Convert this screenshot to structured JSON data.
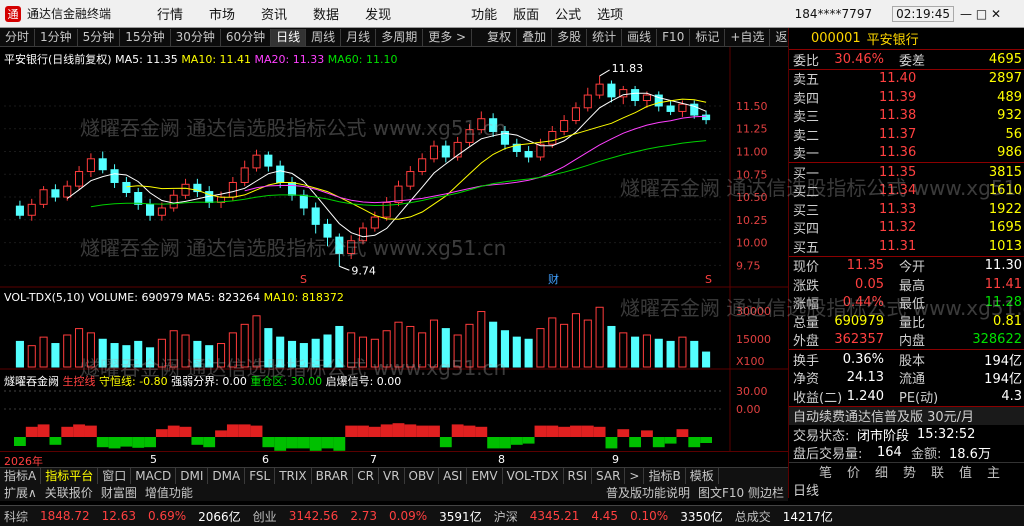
{
  "titlebar": {
    "app_title": "通达信金融终端",
    "menus": [
      "行情",
      "市场",
      "资讯",
      "数据",
      "发现"
    ],
    "menus2": [
      "功能",
      "版面",
      "公式",
      "选项"
    ],
    "user": "184****7797",
    "time": "02:19:45",
    "controls": "— □ ✕"
  },
  "toolbar": {
    "periods": [
      "分时",
      "1分钟",
      "5分钟",
      "15分钟",
      "30分钟",
      "60分钟",
      "日线",
      "周线",
      "月线",
      "多周期",
      "更多 >"
    ],
    "active": "日线",
    "tools": [
      "复权",
      "叠加",
      "多股",
      "统计",
      "画线",
      "F10",
      "标记",
      "+自选",
      "返回"
    ]
  },
  "chart": {
    "main_title": "平安银行(日线前复权)",
    "ma5": "MA5: 11.35",
    "ma10": "MA10: 11.41",
    "ma20": "MA20: 11.33",
    "ma60": "MA60: 11.10",
    "y_ticks": [
      "11.50",
      "11.25",
      "11.00",
      "10.75",
      "10.50",
      "10.25",
      "10.00",
      "9.75"
    ],
    "high_mark": "11.83",
    "low_mark": "9.74",
    "event_marks": [
      "S",
      "财",
      "S"
    ],
    "vol_title": "VOL-TDX(5,10)",
    "volume": "VOLUME: 690979",
    "vol_ma5": "MA5: 823264",
    "vol_ma10": "MA10: 818372",
    "vol_ticks": [
      "30000",
      "15000",
      "X100"
    ],
    "ind_title": "燧曜吞金阙",
    "ind_a": "生控线",
    "ind_b": "守恒线: -0.80",
    "ind_c": "强弱分界: 0.00",
    "ind_d": "重仓区: 30.00",
    "ind_e": "启爆信号: 0.00",
    "ind_ticks": [
      "30.00",
      "0.00"
    ],
    "date_labels": [
      "2026年",
      "5",
      "6",
      "7",
      "8",
      "9"
    ],
    "watermark": "燧曜吞金阙 通达信选股指标公式 www.xg51.cn"
  },
  "chart_data": {
    "type": "candlestick",
    "ylim": [
      9.6,
      11.95
    ],
    "candles": [
      [
        10.4,
        10.3,
        10.46,
        10.26
      ],
      [
        10.3,
        10.42,
        10.48,
        10.24
      ],
      [
        10.42,
        10.58,
        10.62,
        10.38
      ],
      [
        10.58,
        10.5,
        10.64,
        10.45
      ],
      [
        10.5,
        10.62,
        10.68,
        10.46
      ],
      [
        10.62,
        10.78,
        10.84,
        10.58
      ],
      [
        10.78,
        10.92,
        10.98,
        10.72
      ],
      [
        10.92,
        10.8,
        11.0,
        10.76
      ],
      [
        10.8,
        10.66,
        10.86,
        10.6
      ],
      [
        10.66,
        10.55,
        10.72,
        10.5
      ],
      [
        10.55,
        10.42,
        10.6,
        10.36
      ],
      [
        10.42,
        10.3,
        10.48,
        10.24
      ],
      [
        10.3,
        10.38,
        10.44,
        10.24
      ],
      [
        10.38,
        10.52,
        10.58,
        10.34
      ],
      [
        10.52,
        10.64,
        10.7,
        10.48
      ],
      [
        10.64,
        10.56,
        10.7,
        10.5
      ],
      [
        10.56,
        10.44,
        10.62,
        10.38
      ],
      [
        10.44,
        10.5,
        10.56,
        10.38
      ],
      [
        10.5,
        10.66,
        10.72,
        10.46
      ],
      [
        10.66,
        10.82,
        10.9,
        10.62
      ],
      [
        10.82,
        10.96,
        11.02,
        10.78
      ],
      [
        10.96,
        10.84,
        11.0,
        10.78
      ],
      [
        10.84,
        10.66,
        10.9,
        10.6
      ],
      [
        10.66,
        10.52,
        10.72,
        10.46
      ],
      [
        10.52,
        10.38,
        10.58,
        10.3
      ],
      [
        10.38,
        10.2,
        10.44,
        10.1
      ],
      [
        10.2,
        10.06,
        10.26,
        9.96
      ],
      [
        10.06,
        9.88,
        10.1,
        9.74
      ],
      [
        9.88,
        10.02,
        10.08,
        9.82
      ],
      [
        10.02,
        10.16,
        10.22,
        9.98
      ],
      [
        10.16,
        10.28,
        10.34,
        10.12
      ],
      [
        10.28,
        10.44,
        10.5,
        10.24
      ],
      [
        10.44,
        10.62,
        10.68,
        10.4
      ],
      [
        10.62,
        10.78,
        10.84,
        10.58
      ],
      [
        10.78,
        10.92,
        10.98,
        10.74
      ],
      [
        10.92,
        11.06,
        11.12,
        10.88
      ],
      [
        11.06,
        10.94,
        11.12,
        10.88
      ],
      [
        10.94,
        11.1,
        11.16,
        10.9
      ],
      [
        11.1,
        11.24,
        11.3,
        11.06
      ],
      [
        11.24,
        11.36,
        11.44,
        11.2
      ],
      [
        11.36,
        11.22,
        11.42,
        11.16
      ],
      [
        11.22,
        11.08,
        11.28,
        11.02
      ],
      [
        11.08,
        11.0,
        11.14,
        10.94
      ],
      [
        11.0,
        10.94,
        11.06,
        10.88
      ],
      [
        10.94,
        11.08,
        11.14,
        10.9
      ],
      [
        11.08,
        11.22,
        11.28,
        11.04
      ],
      [
        11.22,
        11.34,
        11.4,
        11.18
      ],
      [
        11.34,
        11.48,
        11.54,
        11.3
      ],
      [
        11.48,
        11.62,
        11.7,
        11.44
      ],
      [
        11.62,
        11.74,
        11.83,
        11.58
      ],
      [
        11.74,
        11.6,
        11.78,
        11.54
      ],
      [
        11.6,
        11.68,
        11.72,
        11.52
      ],
      [
        11.68,
        11.56,
        11.72,
        11.5
      ],
      [
        11.56,
        11.62,
        11.66,
        11.48
      ],
      [
        11.62,
        11.5,
        11.66,
        11.44
      ],
      [
        11.5,
        11.44,
        11.56,
        11.4
      ],
      [
        11.44,
        11.52,
        11.56,
        11.38
      ],
      [
        11.52,
        11.4,
        11.56,
        11.36
      ],
      [
        11.4,
        11.35,
        11.45,
        11.3
      ]
    ],
    "volumes": [
      12,
      10,
      14,
      11,
      15,
      18,
      16,
      13,
      11,
      10,
      12,
      9,
      13,
      17,
      15,
      12,
      10,
      11,
      16,
      20,
      24,
      18,
      14,
      12,
      11,
      13,
      15,
      19,
      16,
      14,
      13,
      17,
      21,
      19,
      16,
      22,
      18,
      15,
      20,
      26,
      21,
      17,
      14,
      13,
      18,
      23,
      20,
      25,
      22,
      28,
      19,
      16,
      14,
      15,
      13,
      12,
      14,
      12,
      7
    ]
  },
  "quote": {
    "code": "000001",
    "name": "平安银行",
    "webi": "委比",
    "webi_val": "30.46%",
    "weicha": "委差",
    "weicha_val": "4695",
    "asks": [
      {
        "label": "卖五",
        "price": "11.40",
        "vol": "2897"
      },
      {
        "label": "卖四",
        "price": "11.39",
        "vol": "489"
      },
      {
        "label": "卖三",
        "price": "11.38",
        "vol": "932"
      },
      {
        "label": "卖二",
        "price": "11.37",
        "vol": "56"
      },
      {
        "label": "卖一",
        "price": "11.36",
        "vol": "986"
      }
    ],
    "bids": [
      {
        "label": "买一",
        "price": "11.35",
        "vol": "3815"
      },
      {
        "label": "买二",
        "price": "11.34",
        "vol": "1610"
      },
      {
        "label": "买三",
        "price": "11.33",
        "vol": "1922"
      },
      {
        "label": "买四",
        "price": "11.32",
        "vol": "1695"
      },
      {
        "label": "买五",
        "price": "11.31",
        "vol": "1013"
      }
    ],
    "stats": [
      {
        "l": "现价",
        "v": "11.35",
        "l2": "今开",
        "v2": "11.30",
        "c": "red",
        "c2": "white"
      },
      {
        "l": "涨跌",
        "v": "0.05",
        "l2": "最高",
        "v2": "11.41",
        "c": "red",
        "c2": "red"
      },
      {
        "l": "涨幅",
        "v": "0.44%",
        "l2": "最低",
        "v2": "11.28",
        "c": "red",
        "c2": "green"
      },
      {
        "l": "总量",
        "v": "690979",
        "l2": "量比",
        "v2": "0.81",
        "c": "yellow",
        "c2": "yellow"
      },
      {
        "l": "外盘",
        "v": "362357",
        "l2": "内盘",
        "v2": "328622",
        "c": "red",
        "c2": "green"
      }
    ],
    "stats2": [
      {
        "l": "换手",
        "v": "0.36%",
        "l2": "股本",
        "v2": "194亿"
      },
      {
        "l": "净资",
        "v": "24.13",
        "l2": "流通",
        "v2": "194亿"
      },
      {
        "l": "收益(二)",
        "v": "1.240",
        "l2": "PE(动)",
        "v2": "4.3"
      }
    ],
    "promo": "自动续费通达信普及版 30元/月",
    "trade_state_l": "交易状态:",
    "trade_state": "闭市阶段",
    "trade_time": "15:32:52",
    "after_l": "盘后交易量:",
    "after_v": "164",
    "amount_l": "金额:",
    "amount_v": "18.6万",
    "footer_tabs": [
      "笔",
      "价",
      "细",
      "势",
      "联",
      "值",
      "主"
    ]
  },
  "tabs": {
    "items": [
      "指标A",
      "指标平台",
      "窗口",
      "MACD",
      "DMI",
      "DMA",
      "FSL",
      "TRIX",
      "BRAR",
      "CR",
      "VR",
      "OBV",
      "ASI",
      "EMV",
      "VOL-TDX",
      "RSI",
      "SAR",
      ">",
      "指标B",
      "模板"
    ],
    "active": "指标平台",
    "row2": [
      "扩展∧",
      "关联报价",
      "财富圈",
      "增值功能"
    ],
    "right_info": "普及版功能说明",
    "right_info2": "图文F10 侧边栏",
    "right_date": "日线"
  },
  "status": [
    {
      "name": "科综",
      "val": "1848.72",
      "chg": "12.63",
      "pct": "0.69%",
      "amt": "2066亿"
    },
    {
      "name": "创业",
      "val": "3142.56",
      "chg": "2.73",
      "pct": "0.09%",
      "amt": "3591亿"
    },
    {
      "name": "沪深",
      "val": "4345.21",
      "chg": "4.45",
      "pct": "0.10%",
      "amt": "3350亿"
    }
  ],
  "status_total_l": "总成交",
  "status_total": "14217亿"
}
